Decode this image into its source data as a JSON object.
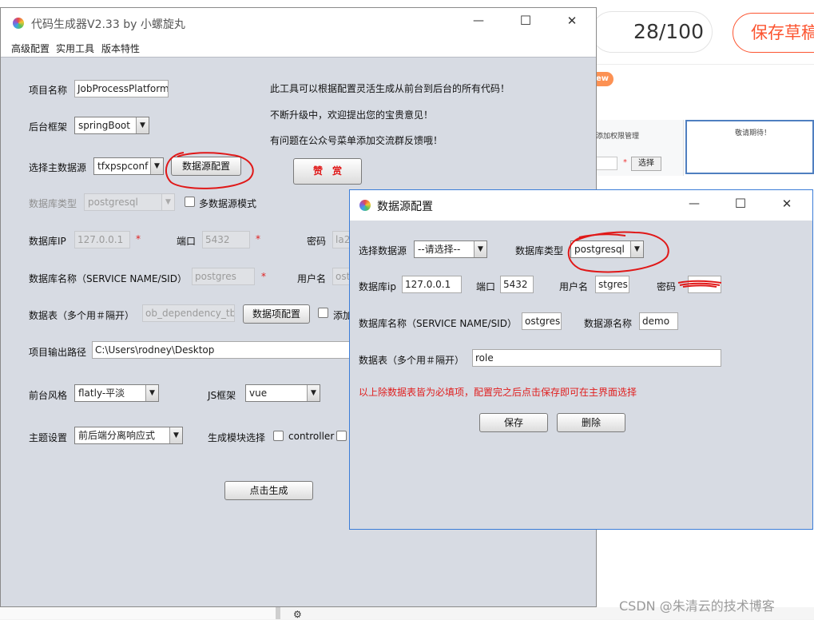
{
  "background": {
    "counter": "28/100",
    "save_draft": "保存草稿",
    "new_badge": "ew",
    "permission_text": "添加权限管理",
    "expect_text": "敬请期待！",
    "star": "*",
    "select_button": "选择",
    "watermark": "CSDN @朱清云的技术博客"
  },
  "main_window": {
    "title": "代码生成器V2.33 by 小螺旋丸",
    "menu": [
      "高级配置",
      "实用工具",
      "版本特性"
    ],
    "project_name_label": "项目名称",
    "project_name_value": "JobProcessPlatform",
    "framework_label": "后台框架",
    "framework_value": "springBoot",
    "main_datasource_label": "选择主数据源",
    "main_datasource_value": "tfxpspconf",
    "datasource_config_button": "数据源配置",
    "db_type_label": "数据库类型",
    "db_type_value": "postgresql",
    "multi_datasource_label": "多数据源模式",
    "db_ip_label": "数据库IP",
    "db_ip_value": "127.0.0.1",
    "port_label": "端口",
    "port_value": "5432",
    "password_label": "密码",
    "password_value": "la2",
    "db_name_label": "数据库名称（SERVICE NAME/SID）",
    "db_name_value": "postgres",
    "user_label": "用户名",
    "user_value": "ost",
    "tables_label": "数据表（多个用＃隔开）",
    "tables_value": "ob_dependency_tbl",
    "table_config_button": "数据项配置",
    "add_label": "添加",
    "output_path_label": "项目输出路径",
    "output_path_value": "C:\\Users\\rodney\\Desktop",
    "style_label": "前台风格",
    "style_value": "flatly-平淡",
    "js_label": "JS框架",
    "js_value": "vue",
    "theme_label": "主题设置",
    "theme_value": "前后端分离响应式",
    "module_label": "生成模块选择",
    "controller_label": "controller",
    "generate_button": "点击生成",
    "star": "*",
    "info_lines": [
      "此工具可以根据配置灵活生成从前台到后台的所有代码！",
      "不断升级中，欢迎提出您的宝贵意见！",
      "有问题在公众号菜单添加交流群反馈哦！"
    ],
    "like_button": "赞　赏"
  },
  "dialog": {
    "title": "数据源配置",
    "select_ds_label": "选择数据源",
    "select_ds_value": "--请选择--",
    "db_type_label": "数据库类型",
    "db_type_value": "postgresql",
    "db_ip_label": "数据库ip",
    "db_ip_value": "127.0.0.1",
    "port_label": "端口",
    "port_value": "5432",
    "user_label": "用户名",
    "user_value": "stgres",
    "password_label": "密码",
    "db_name_label": "数据库名称（SERVICE NAME/SID）",
    "db_name_value": "ostgres",
    "ds_name_label": "数据源名称",
    "ds_name_value": "demo",
    "tables_label": "数据表（多个用＃隔开）",
    "tables_value": "role",
    "note": "以上除数据表皆为必填项，配置完之后点击保存即可在主界面选择",
    "save_button": "保存",
    "delete_button": "删除"
  },
  "window_controls": {
    "minimize": "—",
    "maximize": "☐",
    "close": "✕"
  },
  "colors": {
    "window_bg": "#d7dbe3",
    "annotation_red": "#e01818",
    "note_red": "#e02020",
    "brand_orange": "#fc5531"
  }
}
